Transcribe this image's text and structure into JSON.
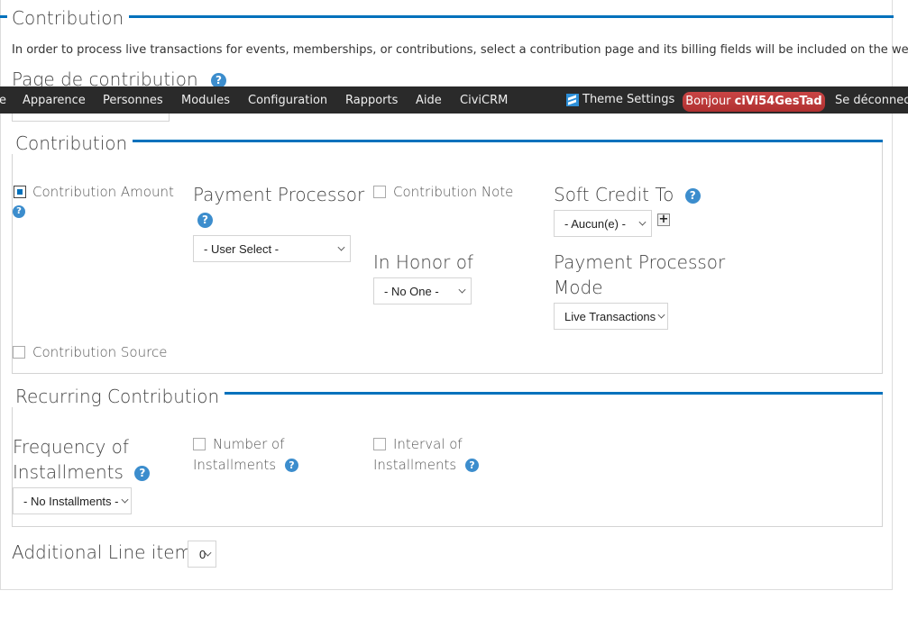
{
  "main_fieldset": {
    "legend": "Contribution",
    "description": "In order to process live transactions for events, memberships, or contributions, select a contribution page and its billing fields will be included on the webform.",
    "page_label": "Page de contribution",
    "help_icon": "question-circle-icon"
  },
  "toolbar": {
    "items": [
      "e",
      "Apparence",
      "Personnes",
      "Modules",
      "Configuration",
      "Rapports",
      "Aide",
      "CiviCRM"
    ],
    "theme_settings": "Theme Settings",
    "greeting_prefix": "Bonjour ",
    "username": "ciVi54GesTad",
    "logout": "Se déconnec",
    "accent": "#b83636"
  },
  "contribution_fieldset": {
    "legend": "Contribution",
    "contribution_amount": {
      "label": "Contribution Amount",
      "checked": true
    },
    "payment_processor": {
      "label": "Payment Processor",
      "value": "- User Select -"
    },
    "contribution_note": {
      "label": "Contribution Note",
      "checked": false
    },
    "soft_credit": {
      "label": "Soft Credit To",
      "value": "- Aucun(e) -",
      "add_label": "+"
    },
    "in_honor_of": {
      "label": "In Honor of",
      "value": "- No One -"
    },
    "processor_mode": {
      "label_line1": "Payment Processor",
      "label_line2": "Mode",
      "value": "Live Transactions"
    },
    "contribution_source": {
      "label": "Contribution Source",
      "checked": false
    }
  },
  "recurring_fieldset": {
    "legend": "Recurring Contribution",
    "frequency": {
      "label_line1": "Frequency of",
      "label_line2": "Installments",
      "value": "- No Installments -"
    },
    "number": {
      "label_line1": "Number of",
      "label_line2": "Installments",
      "checked": false
    },
    "interval": {
      "label_line1": "Interval of",
      "label_line2": "Installments",
      "checked": false
    }
  },
  "additional_line_items": {
    "label": "Additional Line items",
    "value": "0"
  },
  "colors": {
    "accent_blue": "#0071bc",
    "help_blue": "#3c8dcd"
  }
}
